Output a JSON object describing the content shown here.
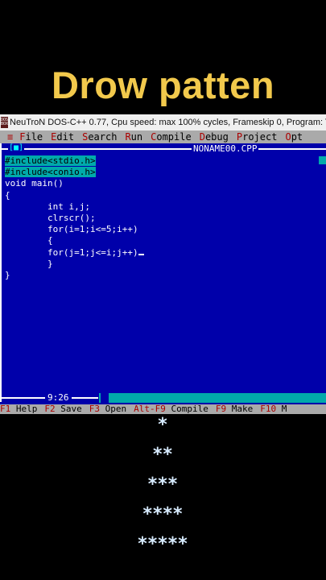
{
  "caption": "Drow patten",
  "window": {
    "icon_label": "DOS BOX",
    "title": "NeuTroN DOS-C++ 0.77, Cpu speed: max 100% cycles, Frameskip  0, Program:    T"
  },
  "menu": {
    "system": "≡",
    "items": [
      {
        "hot": "F",
        "rest": "ile"
      },
      {
        "hot": "E",
        "rest": "dit"
      },
      {
        "hot": "S",
        "rest": "earch"
      },
      {
        "hot": "R",
        "rest": "un"
      },
      {
        "hot": "C",
        "rest": "ompile"
      },
      {
        "hot": "D",
        "rest": "ebug"
      },
      {
        "hot": "P",
        "rest": "roject"
      },
      {
        "hot": "O",
        "rest": "pt"
      }
    ]
  },
  "editor": {
    "close_box": "[■]",
    "filename": "NONAME00.CPP",
    "lines": [
      {
        "text": "#include<stdio.h>",
        "highlight": true
      },
      {
        "text": "#include<conio.h>",
        "highlight": true
      },
      {
        "text": "void main()",
        "highlight": false
      },
      {
        "text": "{",
        "highlight": false
      },
      {
        "text": "        int i,j;",
        "highlight": false
      },
      {
        "text": "        clrscr();",
        "highlight": false
      },
      {
        "text": "        for(i=1;i<=5;i++)",
        "highlight": false
      },
      {
        "text": "        {",
        "highlight": false
      },
      {
        "text": "        for(j=1;j<=i;j++)",
        "highlight": false,
        "cursor": true
      },
      {
        "text": "        }",
        "highlight": false
      },
      {
        "text": "}",
        "highlight": false
      }
    ],
    "cursor_position": "9:26"
  },
  "function_keys": [
    {
      "key": "F1",
      "label": "Help"
    },
    {
      "key": "F2",
      "label": "Save"
    },
    {
      "key": "F3",
      "label": "Open"
    },
    {
      "key": "Alt-F9",
      "label": "Compile"
    },
    {
      "key": "F9",
      "label": "Make"
    },
    {
      "key": "F10",
      "label": "M"
    }
  ],
  "output_rows": [
    "*",
    "**",
    "***",
    "****",
    "*****"
  ],
  "colors": {
    "caption": "#f2c94c",
    "dos_background": "#0000aa",
    "menu_background": "#aaaaaa",
    "hotkey": "#aa0000",
    "include_highlight": "#00aaaa",
    "stars": "#d8ecff"
  }
}
